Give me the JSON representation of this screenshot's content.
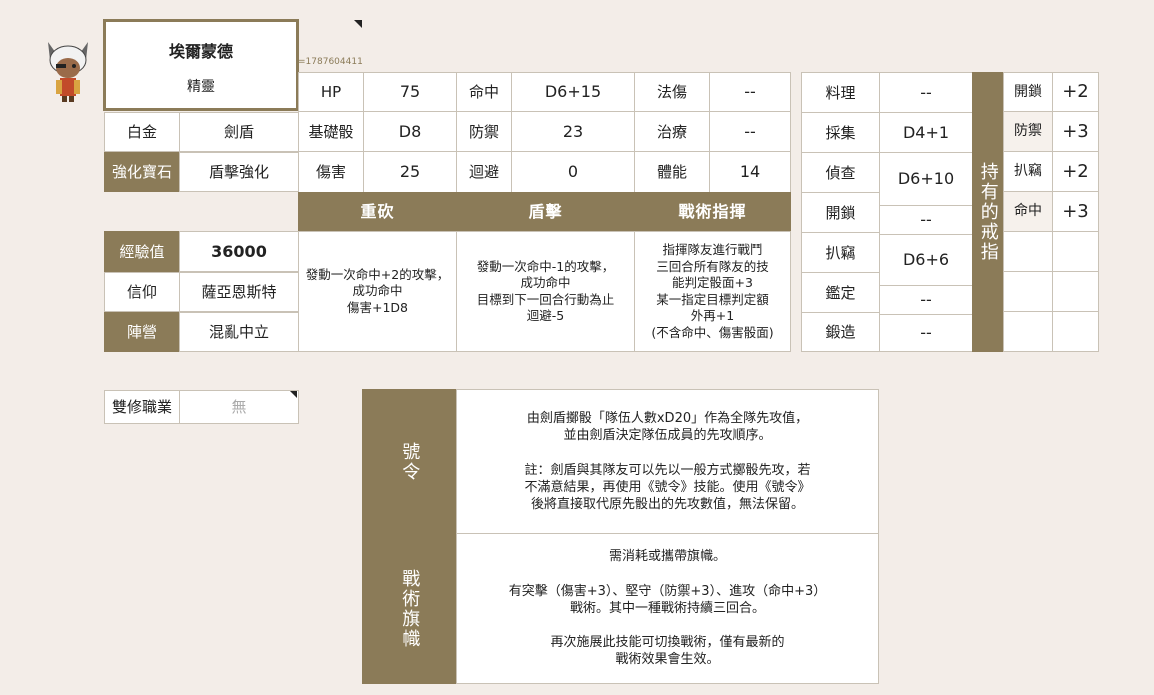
{
  "character": {
    "name": "埃爾蒙德",
    "race": "精靈",
    "id_text": "=1787604411"
  },
  "left": {
    "platinum_label": "白金",
    "class_label": "劍盾",
    "gem_label": "強化寶石",
    "gem_value": "盾擊強化",
    "exp_label": "經驗值",
    "exp_value": "36000",
    "faith_label": "信仰",
    "faith_value": "薩亞恩斯特",
    "camp_label": "陣營",
    "camp_value": "混亂中立",
    "dual_label": "雙修職業",
    "dual_value": "無"
  },
  "stats": {
    "hp_label": "HP",
    "hp_value": "75",
    "hit_label": "命中",
    "hit_value": "D6+15",
    "mdmg_label": "法傷",
    "mdmg_value": "--",
    "base_label": "基礎骰",
    "base_value": "D8",
    "def_label": "防禦",
    "def_value": "23",
    "heal_label": "治療",
    "heal_value": "--",
    "dmg_label": "傷害",
    "dmg_value": "25",
    "eva_label": "迴避",
    "eva_value": "0",
    "sta_label": "體能",
    "sta_value": "14"
  },
  "skills": [
    {
      "name": "重砍",
      "desc": "發動一次命中+2的攻擊，成功命中\n傷害+1D8"
    },
    {
      "name": "盾擊",
      "desc": "發動一次命中-1的攻擊，\n成功命中\n目標到下一回合行動為止\n迴避-5"
    },
    {
      "name": "戰術指揮",
      "desc": "指揮隊友進行戰鬥\n三回合所有隊友的技\n能判定骰面+3\n某一指定目標判定額\n外再+1\n(不含命中、傷害骰面)"
    }
  ],
  "life": [
    {
      "label": "料理",
      "value": "--"
    },
    {
      "label": "採集",
      "value": "D4+1"
    },
    {
      "label": "偵查",
      "value": "D6+10"
    },
    {
      "label": "開鎖",
      "value": "--"
    },
    {
      "label": "扒竊",
      "value": "D6+6"
    },
    {
      "label": "鑑定",
      "value": "--"
    },
    {
      "label": "鍛造",
      "value": "--"
    }
  ],
  "rings": {
    "title": "持有的戒指",
    "items": [
      {
        "label": "開鎖",
        "value": "+2"
      },
      {
        "label": "防禦",
        "value": "+3"
      },
      {
        "label": "扒竊",
        "value": "+2"
      },
      {
        "label": "命中",
        "value": "+3"
      }
    ]
  },
  "abilities": [
    {
      "name": "號令",
      "desc": "由劍盾擲骰「隊伍人數xD20」作為全隊先攻值，\n並由劍盾決定隊伍成員的先攻順序。\n\n註：劍盾與其隊友可以先以一般方式擲骰先攻，若\n不滿意結果，再使用《號令》技能。使用《號令》\n後將直接取代原先骰出的先攻數值，無法保留。"
    },
    {
      "name": "戰術旗幟",
      "desc": "需消耗或攜帶旗幟。\n\n有突擊（傷害+3）、堅守（防禦+3）、進攻（命中+3）\n戰術。其中一種戰術持續三回合。\n\n再次施展此技能可切換戰術，僅有最新的\n戰術效果會生效。"
    }
  ]
}
